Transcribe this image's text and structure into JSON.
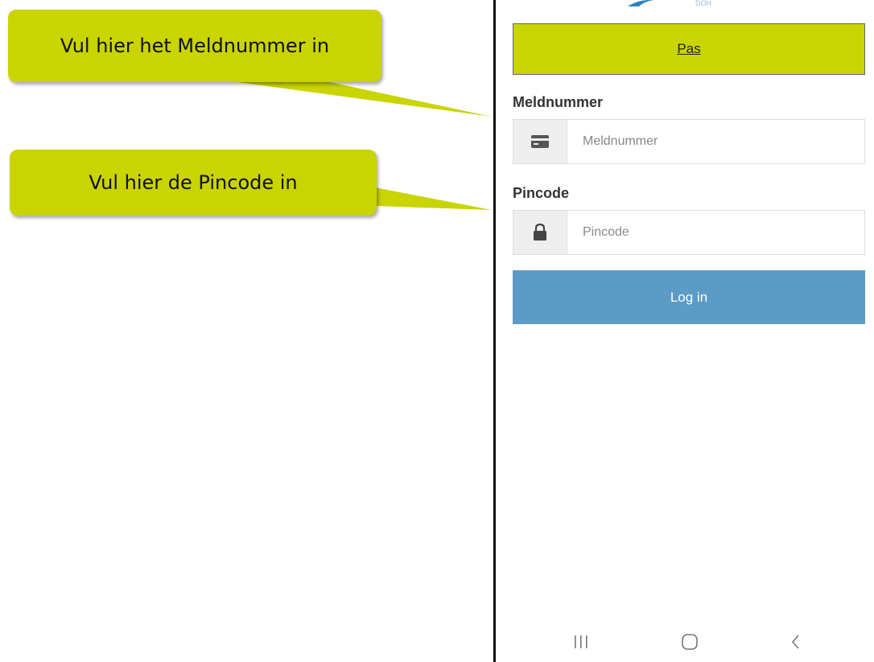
{
  "annotations": {
    "callout_meldnummer": "Vul hier het Meldnummer in",
    "callout_pincode": "Vul hier de Pincode in",
    "color": "#c9d400"
  },
  "header": {
    "logo_text_fragment": "DOH"
  },
  "tabs": {
    "pas_label": "Pas",
    "active_color": "#c9d400"
  },
  "form": {
    "meldnummer": {
      "label": "Meldnummer",
      "placeholder": "Meldnummer",
      "value": "",
      "icon": "credit-card-icon"
    },
    "pincode": {
      "label": "Pincode",
      "placeholder": "Pincode",
      "value": "",
      "icon": "lock-icon"
    },
    "login_label": "Log in",
    "login_color": "#5b9bc6"
  },
  "system_nav": {
    "recent_icon": "recent-apps-icon",
    "home_icon": "home-icon",
    "back_icon": "back-icon"
  }
}
